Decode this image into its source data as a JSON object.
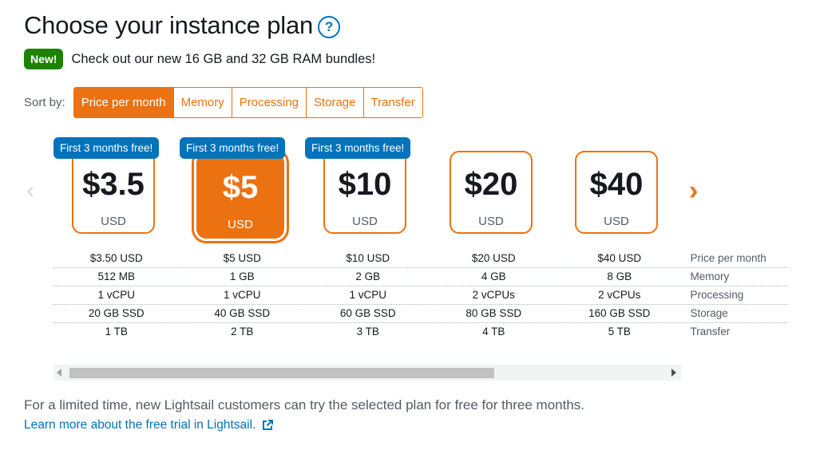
{
  "header": {
    "title": "Choose your instance plan",
    "help_icon": "?",
    "new_badge": "New!",
    "announcement": "Check out our new 16 GB and 32 GB RAM bundles!"
  },
  "sort": {
    "label": "Sort by:",
    "options": [
      "Price per month",
      "Memory",
      "Processing",
      "Storage",
      "Transfer"
    ],
    "active": "Price per month"
  },
  "colors": {
    "accent": "#ec7211",
    "promo": "#0073bb",
    "new_badge": "#1d8102",
    "link": "#0073bb"
  },
  "carousel": {
    "prev_icon": "‹",
    "next_icon": "›"
  },
  "plans": [
    {
      "promo": "First 3 months free!",
      "price": "$3.5",
      "currency": "USD",
      "selected": false
    },
    {
      "promo": "First 3 months free!",
      "price": "$5",
      "currency": "USD",
      "selected": true
    },
    {
      "promo": "First 3 months free!",
      "price": "$10",
      "currency": "USD",
      "selected": false
    },
    {
      "promo": "",
      "price": "$20",
      "currency": "USD",
      "selected": false
    },
    {
      "promo": "",
      "price": "$40",
      "currency": "USD",
      "selected": false
    }
  ],
  "specs": {
    "rows": [
      {
        "label": "Price per month",
        "values": [
          "$3.50 USD",
          "$5 USD",
          "$10 USD",
          "$20 USD",
          "$40 USD"
        ]
      },
      {
        "label": "Memory",
        "values": [
          "512 MB",
          "1 GB",
          "2 GB",
          "4 GB",
          "8 GB"
        ]
      },
      {
        "label": "Processing",
        "values": [
          "1 vCPU",
          "1 vCPU",
          "1 vCPU",
          "2 vCPUs",
          "2 vCPUs"
        ]
      },
      {
        "label": "Storage",
        "values": [
          "20 GB SSD",
          "40 GB SSD",
          "60 GB SSD",
          "80 GB SSD",
          "160 GB SSD"
        ]
      },
      {
        "label": "Transfer",
        "values": [
          "1 TB",
          "2 TB",
          "3 TB",
          "4 TB",
          "5 TB"
        ]
      }
    ]
  },
  "footer": {
    "text": "For a limited time, new Lightsail customers can try the selected plan for free for three months.",
    "link": "Learn more about the free trial in Lightsail."
  }
}
